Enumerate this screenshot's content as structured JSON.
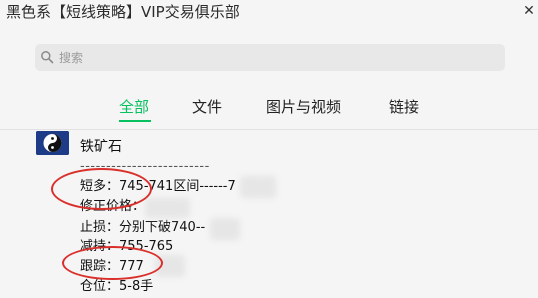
{
  "window": {
    "title": "黑色系【短线策略】VIP交易俱乐部",
    "close_label": "✕"
  },
  "search": {
    "placeholder": "搜索",
    "icon": "search-icon"
  },
  "tabs": [
    {
      "label": "全部",
      "active": true
    },
    {
      "label": "文件",
      "active": false
    },
    {
      "label": "图片与视频",
      "active": false
    },
    {
      "label": "链接",
      "active": false
    }
  ],
  "accent_color": "#07c160",
  "annotation_color": "#d9302c",
  "message": {
    "sender": "铁矿石",
    "lines": [
      "-------------------------",
      "短多：745-741区间------7",
      "修正价格：",
      "止损：分别下破740--",
      "减持：755-765",
      "跟踪：777",
      "仓位：5-8手"
    ]
  }
}
